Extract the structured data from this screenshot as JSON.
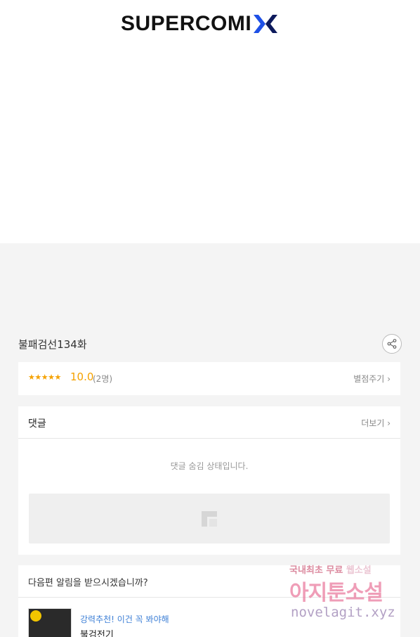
{
  "header": {
    "logo_text": "SUPERCOMI",
    "logo_colors": {
      "text": "#111111",
      "x_left": "#1e50e6",
      "x_right": "#0d1a5c"
    }
  },
  "episode": {
    "title": "불패검선134화",
    "share_icon": "share-icon"
  },
  "rating": {
    "stars": "★★★★★",
    "score": "10.0",
    "count": "(2명)",
    "rate_link": "별점주기",
    "accent": "#f5a200"
  },
  "comments": {
    "title": "댓글",
    "more_link": "더보기",
    "hidden_message": "댓글 숨김 상태입니다."
  },
  "notify": {
    "question": "다음편 알림을 받으시겠습니까?",
    "recommend_tag": "강력추천! 이건 꼭 봐야해",
    "recommend_title": "불검전기"
  },
  "watermark": {
    "line1_a": "국내최초 무료",
    "line1_b": "웹소설",
    "line2": "아지툰소설",
    "line3": "novelagit.xyz"
  }
}
